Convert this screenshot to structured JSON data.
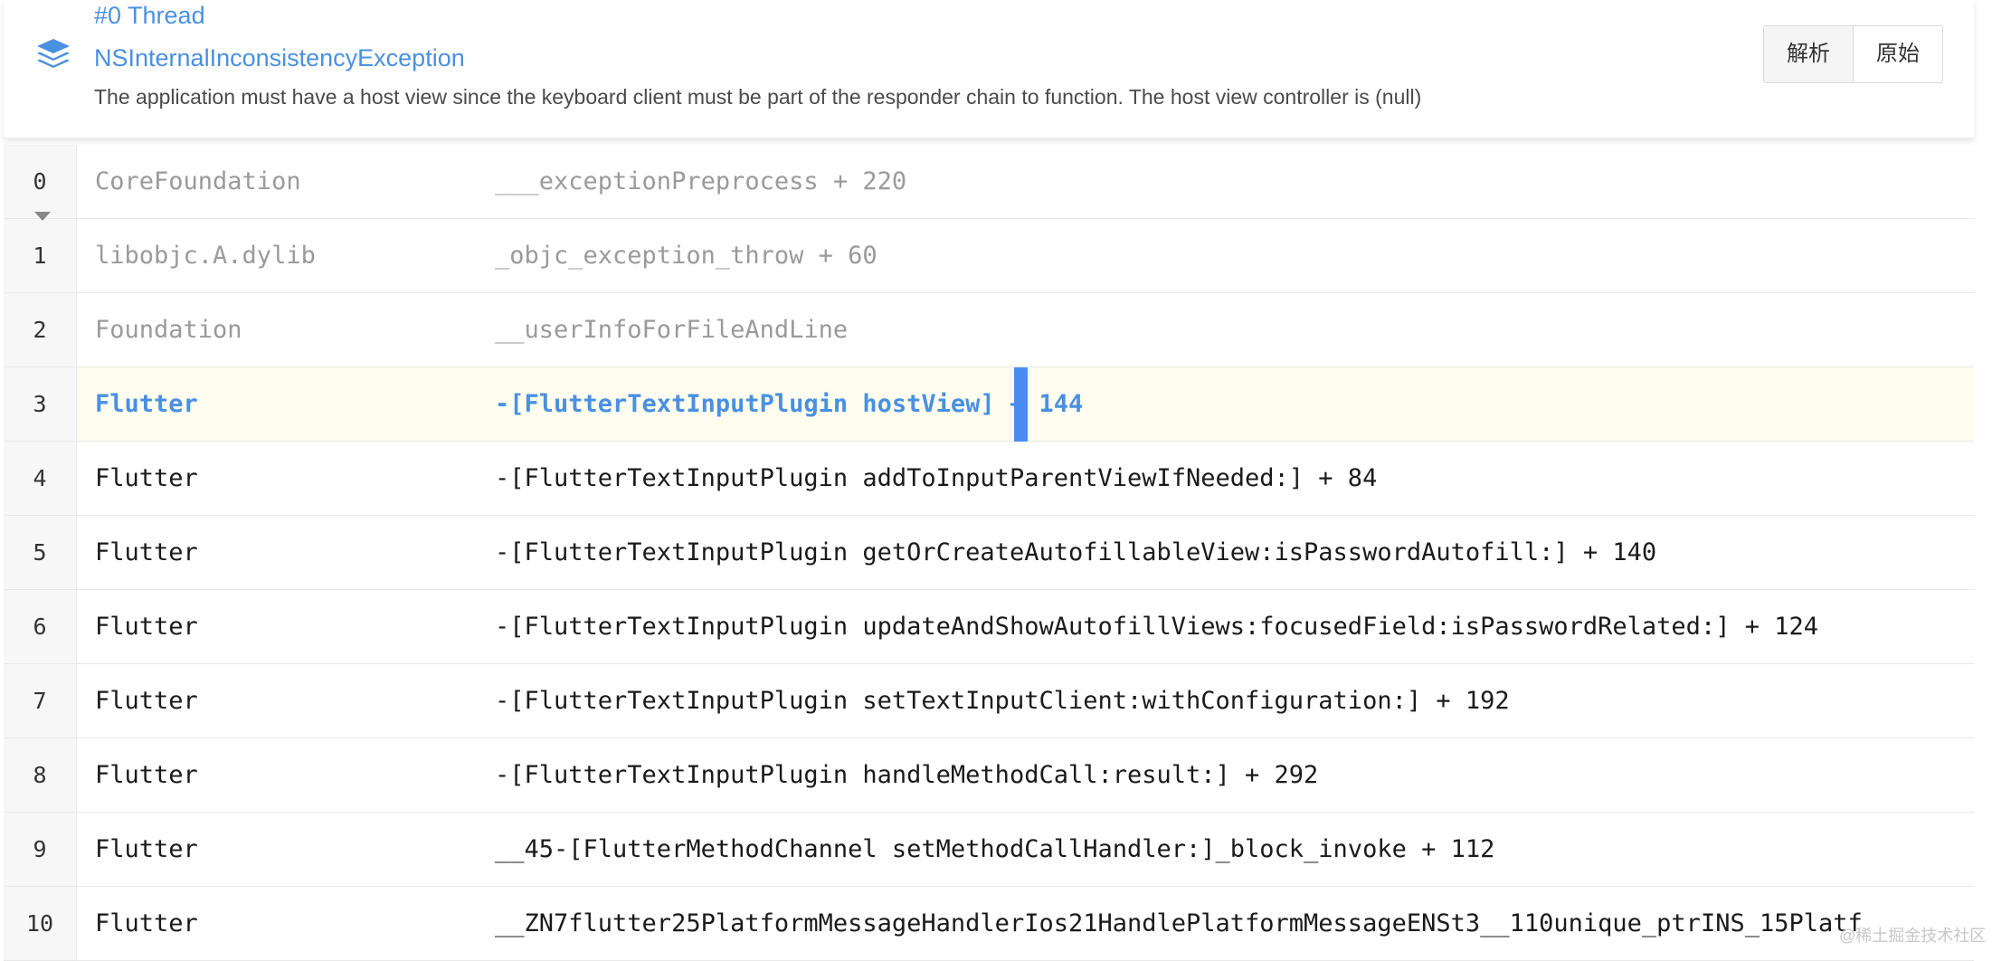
{
  "header": {
    "thread_title": "#0 Thread",
    "exception_name": "NSInternalInconsistencyException",
    "message": "The application must have a host view since the keyboard client must be part of the responder chain to function. The host view controller is (null)",
    "icon": "layers-icon",
    "buttons": {
      "parsed": "解析",
      "raw": "原始"
    }
  },
  "frames": [
    {
      "index": "0",
      "module": "CoreFoundation",
      "symbol": "___exceptionPreprocess + 220"
    },
    {
      "index": "1",
      "module": "libobjc.A.dylib",
      "symbol": "_objc_exception_throw + 60"
    },
    {
      "index": "2",
      "module": "Foundation",
      "symbol": "__userInfoForFileAndLine"
    },
    {
      "index": "3",
      "module": "Flutter",
      "symbol": "-[FlutterTextInputPlugin hostView] + 144"
    },
    {
      "index": "4",
      "module": "Flutter",
      "symbol": "-[FlutterTextInputPlugin addToInputParentViewIfNeeded:] + 84"
    },
    {
      "index": "5",
      "module": "Flutter",
      "symbol": "-[FlutterTextInputPlugin getOrCreateAutofillableView:isPasswordAutofill:] + 140"
    },
    {
      "index": "6",
      "module": "Flutter",
      "symbol": "-[FlutterTextInputPlugin updateAndShowAutofillViews:focusedField:isPasswordRelated:] + 124"
    },
    {
      "index": "7",
      "module": "Flutter",
      "symbol": "-[FlutterTextInputPlugin setTextInputClient:withConfiguration:] + 192"
    },
    {
      "index": "8",
      "module": "Flutter",
      "symbol": "-[FlutterTextInputPlugin handleMethodCall:result:] + 292"
    },
    {
      "index": "9",
      "module": "Flutter",
      "symbol": "__45-[FlutterMethodChannel setMethodCallHandler:]_block_invoke + 112"
    },
    {
      "index": "10",
      "module": "Flutter",
      "symbol": "__ZN7flutter25PlatformMessageHandlerIos21HandlePlatformMessageENSt3__110unique_ptrINS_15Platf"
    }
  ],
  "watermark": "@稀土掘金技术社区",
  "colors": {
    "accent": "#4a90e2",
    "highlight_row_bg": "#fffdf0",
    "cursor": "#4a8df0",
    "system_frame_text": "#9a9a9a"
  }
}
